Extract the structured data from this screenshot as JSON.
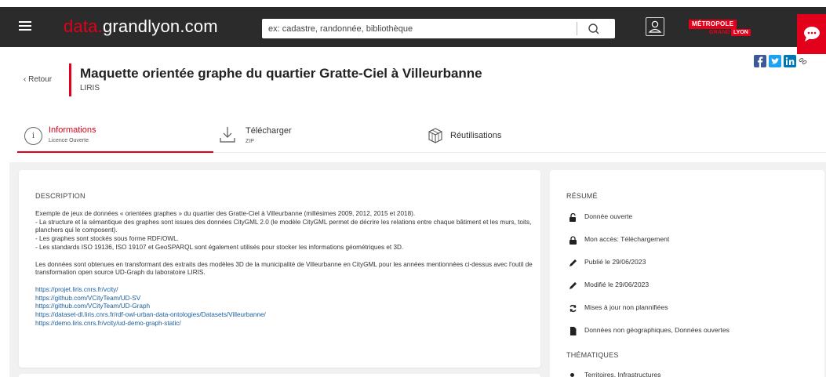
{
  "header": {
    "logo_accent": "data.",
    "logo_rest": "grandlyon.com",
    "search_placeholder": "ex: cadastre, randonnée, bibliothèque",
    "metro_line1": "MÉTROPOLE",
    "metro_line2": "GRAND",
    "metro_line3": "LYON",
    "brand_color": "#e2001a"
  },
  "page": {
    "back_label": "Retour",
    "title": "Maquette orientée graphe du quartier Gratte-Ciel à Villeurbanne",
    "producer": "LIRIS"
  },
  "share": [
    "facebook-icon",
    "twitter-icon",
    "linkedin-icon",
    "link-icon"
  ],
  "tabs": [
    {
      "label": "Informations",
      "sub": "Licence Ouverte",
      "icon": "info-icon"
    },
    {
      "label": "Télécharger",
      "sub": "ZIP",
      "icon": "download-icon"
    },
    {
      "label": "Réutilisations",
      "sub": "",
      "icon": "cube-icon"
    }
  ],
  "description": {
    "heading": "DESCRIPTION",
    "p1": "Exemple de jeux de données « orientées graphes » du quartier des Gratte-Ciel à Villeurbanne (millésimes 2009, 2012, 2015 et 2018).",
    "p2": "- La structure et la sémantique des graphes sont issues des données CityGML 2.0 (le modèle CityGML permet de décrire les relations entre chaque bâtiment et les murs, toits, planchers qui le composent).",
    "p3": "- Les graphes sont stockés sous forme RDF/OWL.",
    "p4": "- Les standards ISO 19136, ISO 19107 et GeoSPARQL sont également utilisés pour stocker les informations géométriques et 3D.",
    "p5": "Les données sont obtenues en transformant des extraits des modèles 3D de la municipalité de Villeurbanne en CityGML pour les années mentionnées ci-dessus avec l'outil de transformation open source UD-Graph du laboratoire LIRIS.",
    "links": [
      "https://projet.liris.cnrs.fr/vcity/",
      "https://github.com/VCityTeam/UD-SV",
      "https://github.com/VCityTeam/UD-Graph",
      "https://dataset-dl.liris.cnrs.fr/rdf-owl-urban-data-ontologies/Datasets/Villeurbanne/",
      "https://demo.liris.cnrs.fr/vcity/ud-demo-graph-static/"
    ]
  },
  "summary": {
    "heading": "RÉSUMÉ",
    "items": [
      {
        "icon": "unlock-icon",
        "text": "Donnée ouverte"
      },
      {
        "icon": "lock-icon",
        "text": "Mon accès: Téléchargement"
      },
      {
        "icon": "pencil-icon",
        "text": "Publié le 29/06/2023"
      },
      {
        "icon": "pencil-icon",
        "text": "Modifié le 29/06/2023"
      },
      {
        "icon": "refresh-icon",
        "text": "Mises à jour non plannifiées"
      },
      {
        "icon": "file-icon",
        "text": "Données non géographiques, Données ouvertes"
      }
    ],
    "themes_heading": "THÉMATIQUES",
    "themes": [
      "Territoires, Infrastructures"
    ]
  }
}
